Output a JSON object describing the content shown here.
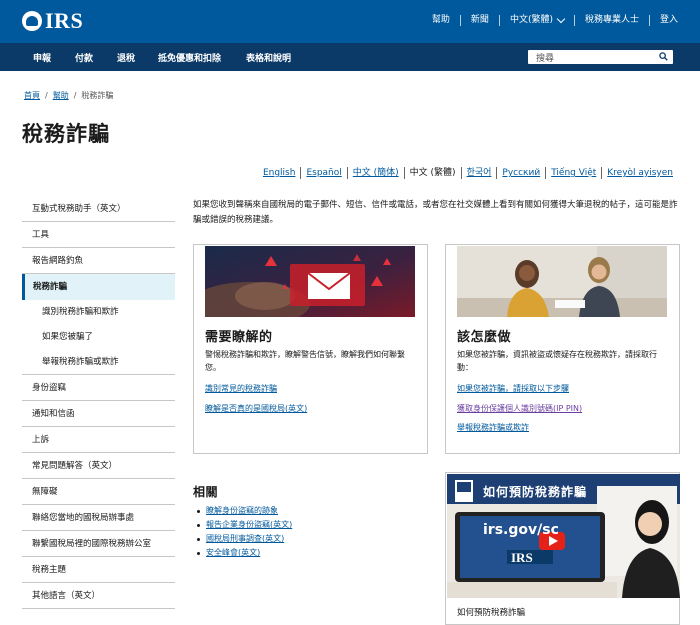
{
  "header": {
    "logo_text": "IRS",
    "util_links": [
      "幫助",
      "新聞",
      "中文(繁體)",
      "稅務專業人士",
      "登入"
    ]
  },
  "mainnav": {
    "items": [
      "申報",
      "付款",
      "退稅",
      "抵免優惠和扣除",
      "表格和說明"
    ],
    "search_placeholder": "搜尋"
  },
  "breadcrumb": [
    "首頁",
    "幫助",
    "稅務詐騙"
  ],
  "page_title": "稅務詐騙",
  "languages": [
    {
      "label": "English",
      "current": false
    },
    {
      "label": "Español",
      "current": false
    },
    {
      "label": "中文 (簡体)",
      "current": false
    },
    {
      "label": "中文 (繁體)",
      "current": true
    },
    {
      "label": "한국어",
      "current": false
    },
    {
      "label": "Русский",
      "current": false
    },
    {
      "label": "Tiếng Việt",
      "current": false
    },
    {
      "label": "Kreyòl ayisyen",
      "current": false
    }
  ],
  "sidebar": {
    "items": [
      {
        "label": "互動式稅務助手（英文）"
      },
      {
        "label": "工具"
      },
      {
        "label": "報告網路釣魚"
      },
      {
        "label": "稅務詐騙"
      },
      {
        "label": "識別稅務詐騙和欺詐"
      },
      {
        "label": "如果您被騙了"
      },
      {
        "label": "舉報稅務詐騙或欺詐"
      },
      {
        "label": "身份盜竊"
      },
      {
        "label": "通知和信函"
      },
      {
        "label": "上訴"
      },
      {
        "label": "常見問題解答（英文）"
      },
      {
        "label": "無障礙"
      },
      {
        "label": "聯絡您當地的國稅局辦事處"
      },
      {
        "label": "聯繫國稅局裡的國際稅務辦公室"
      },
      {
        "label": "稅務主題"
      },
      {
        "label": "其他語言（英文）"
      }
    ]
  },
  "intro": "如果您收到聲稱來自國稅局的電子郵件、短信、信件或電話，或者您在社交媒體上看到有關如何獲得大筆退稅的帖子，這可能是詐騙或錯誤的稅務建議。",
  "cards": [
    {
      "title": "需要瞭解的",
      "desc": "警惕稅務詐騙和欺詐，瞭解警告信號，瞭解我們如何聯繫您。",
      "links": [
        "識別常見的稅務詐騙",
        "瞭解是否真的是國稅局(英文)"
      ]
    },
    {
      "title": "該怎麼做",
      "desc": "如果您被詐騙，資訊被盜或懷疑存在稅務欺詐，請採取行動：",
      "links": [
        "如果您被詐騙，請採取以下步驟",
        "獲取身份保護個人識別號碼(IP PIN)",
        "舉報稅務詐騙或欺詐"
      ]
    }
  ],
  "related": {
    "title": "相關",
    "links": [
      "瞭解身份盜竊的跡象",
      "報告企業身份盜竊(英文)",
      "國稅局刑事調查(英文)",
      "安全峰會(英文)"
    ]
  },
  "video": {
    "title_overlay": "如何預防稅務詐騙",
    "screen_text": "irs.gov/sc",
    "screen_logo": "IRS",
    "caption": "如何預防稅務詐騙"
  }
}
